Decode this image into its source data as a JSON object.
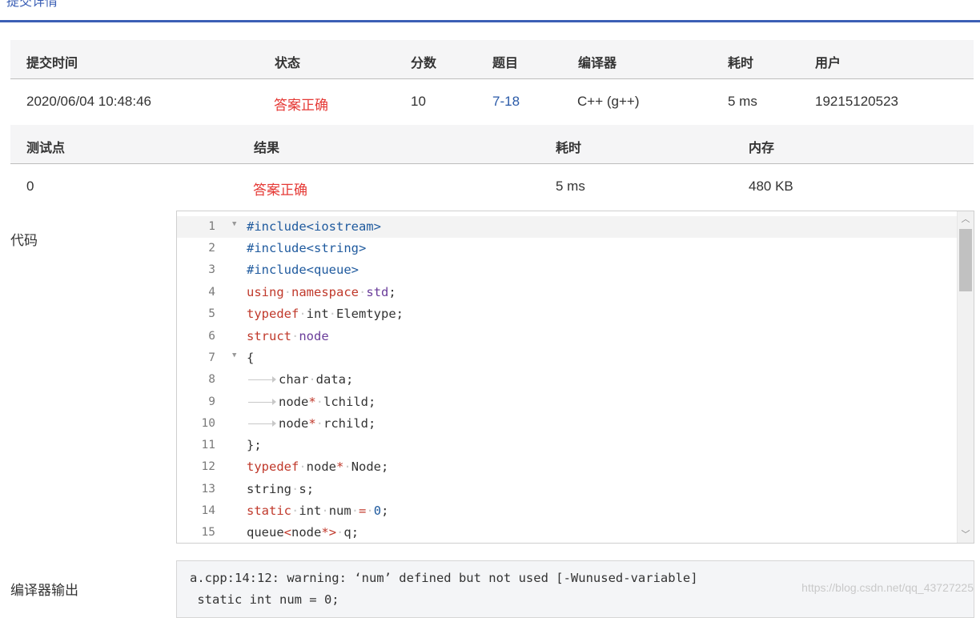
{
  "page": {
    "top_clipped_text": "提交详情"
  },
  "submission_table": {
    "headers": [
      "提交时间",
      "状态",
      "分数",
      "题目",
      "编译器",
      "耗时",
      "用户"
    ],
    "row": {
      "time": "2020/06/04 10:48:46",
      "status": "答案正确",
      "score": "10",
      "problem": "7-18",
      "compiler": "C++ (g++)",
      "elapsed": "5 ms",
      "user": "19215120523"
    }
  },
  "testcase_table": {
    "headers": [
      "测试点",
      "结果",
      "耗时",
      "内存"
    ],
    "row": {
      "case": "0",
      "result": "答案正确",
      "elapsed": "5 ms",
      "memory": "480 KB"
    }
  },
  "code_section": {
    "label": "代码",
    "line_numbers": [
      "1",
      "2",
      "3",
      "4",
      "5",
      "6",
      "7",
      "8",
      "9",
      "10",
      "11",
      "12",
      "13",
      "14",
      "15"
    ],
    "tokens": {
      "l1": "#include<iostream>",
      "l2": "#include<string>",
      "l3": "#include<queue>",
      "using": "using",
      "namespace": "namespace",
      "std": "std",
      "semi": ";",
      "typedef": "typedef",
      "int": "int",
      "elemtype": "Elemtype",
      "struct": "struct",
      "node": "node",
      "lbrace": "{",
      "char": "char",
      "data": "data",
      "star": "*",
      "lchild": "lchild",
      "rchild": "rchild",
      "rbrace_semi": "};",
      "Node": "Node",
      "string": "string",
      "s": "s",
      "static": "static",
      "num": "num",
      "eq": "=",
      "zero": "0",
      "queue": "queue",
      "lt": "<",
      "gt": ">",
      "q": "q"
    }
  },
  "compiler_output": {
    "label": "编译器输出",
    "lines": [
      "a.cpp:14:12: warning: ‘num’ defined but not used [-Wunused-variable]",
      " static int num = 0;"
    ]
  },
  "watermark": "https://blog.csdn.net/qq_43727225"
}
